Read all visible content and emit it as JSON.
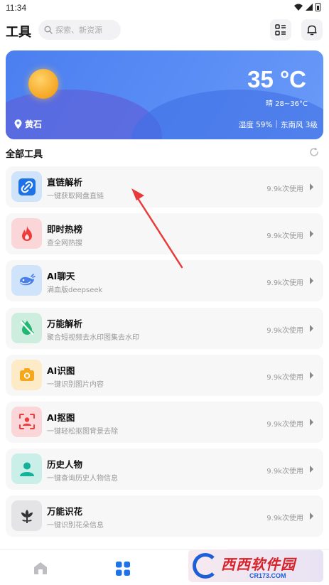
{
  "status_bar": {
    "time": "11:34"
  },
  "header": {
    "title": "工具",
    "search_placeholder": "探索、新资源"
  },
  "weather": {
    "temperature": "35 °C",
    "condition_range": "晴 28~36°C",
    "location": "黄石",
    "humidity": "湿度 59%",
    "divider": "|",
    "wind": "东南风 3级"
  },
  "section": {
    "title": "全部工具"
  },
  "tools": [
    {
      "name": "直链解析",
      "desc": "一键获取网盘直链",
      "usage": "9.9k次使用",
      "icon": "link-icon",
      "bg": "#cfe3fb",
      "fg": "#1e72e8"
    },
    {
      "name": "即时热榜",
      "desc": "查全网热搜",
      "usage": "9.9k次使用",
      "icon": "flame-icon",
      "bg": "#fbd6d8",
      "fg": "#ef3b3b"
    },
    {
      "name": "AI聊天",
      "desc": "满血版deepseek",
      "usage": "9.9k次使用",
      "icon": "whale-icon",
      "bg": "#cfe3fb",
      "fg": "#4a7fe8"
    },
    {
      "name": "万能解析",
      "desc": "聚合短视频去水印图集去水印",
      "usage": "9.9k次使用",
      "icon": "drop-icon",
      "bg": "#cdeede",
      "fg": "#1fb870"
    },
    {
      "name": "AI识图",
      "desc": "一键识别图片内容",
      "usage": "9.9k次使用",
      "icon": "camera-icon",
      "bg": "#fdebc8",
      "fg": "#f6a81c"
    },
    {
      "name": "AI抠图",
      "desc": "一键轻松抠图背景去除",
      "usage": "9.9k次使用",
      "icon": "face-scan-icon",
      "bg": "#fbd6d8",
      "fg": "#ef3b3b"
    },
    {
      "name": "历史人物",
      "desc": "一键查询历史人物信息",
      "usage": "9.9k次使用",
      "icon": "person-icon",
      "bg": "#c9efe8",
      "fg": "#14b29a"
    },
    {
      "name": "万能识花",
      "desc": "一键识别花朵信息",
      "usage": "9.9k次使用",
      "icon": "flower-icon",
      "bg": "#e4e4e6",
      "fg": "#333333"
    }
  ],
  "watermark": {
    "brand": "西西软件园",
    "domain": "CR173.COM"
  },
  "colors": {
    "accent": "#1e72e8",
    "card_bg": "#f7f7f8",
    "weather_bg": "#5a8df5"
  }
}
